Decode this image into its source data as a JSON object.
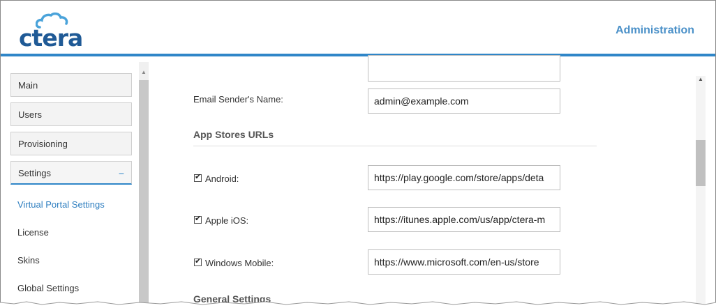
{
  "header": {
    "logo_text": "ctera",
    "admin_link": "Administration"
  },
  "sidebar": {
    "items": [
      {
        "label": "Main"
      },
      {
        "label": "Users"
      },
      {
        "label": "Provisioning"
      },
      {
        "label": "Settings",
        "toggle": "−"
      }
    ],
    "sub_items": [
      {
        "label": "Virtual Portal Settings"
      },
      {
        "label": "License"
      },
      {
        "label": "Skins"
      },
      {
        "label": "Global Settings"
      }
    ]
  },
  "form": {
    "email_sender": {
      "label": "Email Sender's Name:",
      "value": "admin@example.com"
    },
    "app_stores_title": "App Stores URLs",
    "android": {
      "label": "Android:",
      "checked": true,
      "value": "https://play.google.com/store/apps/deta"
    },
    "apple": {
      "label": "Apple iOS:",
      "checked": true,
      "value": "https://itunes.apple.com/us/app/ctera-m"
    },
    "windows": {
      "label": "Windows Mobile:",
      "checked": true,
      "value": "https://www.microsoft.com/en-us/store"
    },
    "general_title": "General Settings"
  },
  "colors": {
    "accent": "#2f86c8",
    "brand": "#1f5a96",
    "selected_link": "#2f7fc0"
  }
}
